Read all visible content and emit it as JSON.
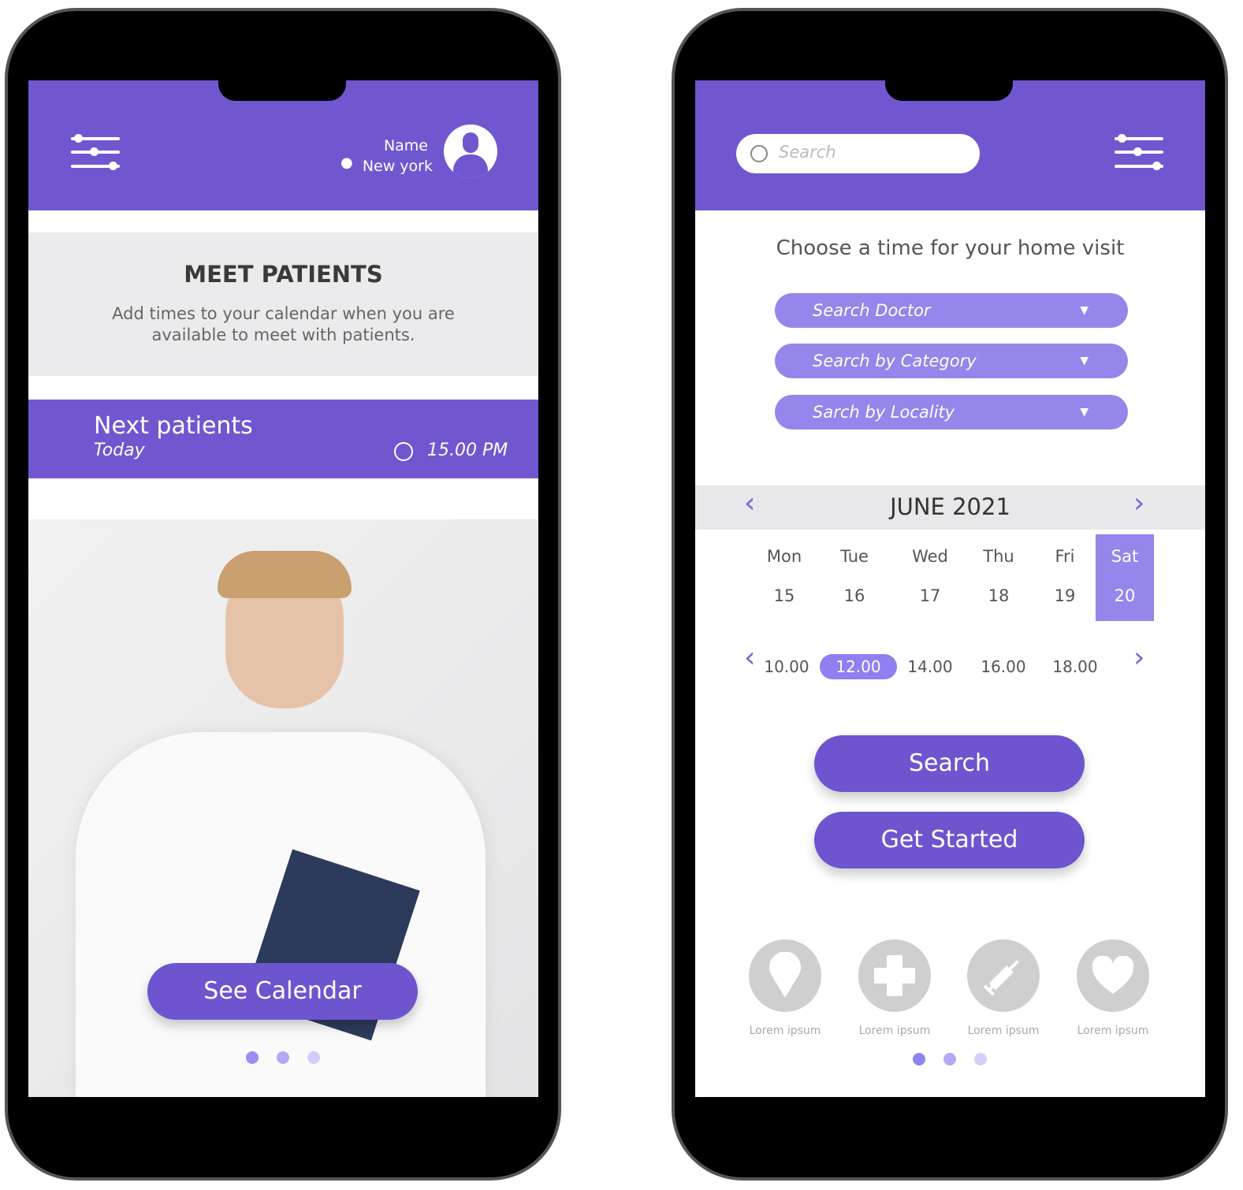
{
  "left": {
    "header": {
      "name": "Name",
      "location": "New york"
    },
    "meet": {
      "title": "MEET PATIENTS",
      "description_line1": "Add times to your calendar when you are",
      "description_line2": "available to meet with patients."
    },
    "next": {
      "title": "Next patients",
      "day": "Today",
      "time": "15.00 PM"
    },
    "cta": "See Calendar",
    "pager": {
      "count": 3,
      "active": 0
    }
  },
  "right": {
    "search_placeholder": "Search",
    "heading": "Choose a time for your home visit",
    "dropdowns": [
      "Search Doctor",
      "Search by Category",
      "Sarch by Locality"
    ],
    "calendar": {
      "month": "JUNE 2021",
      "days": [
        {
          "name": "Mon",
          "date": "15"
        },
        {
          "name": "Tue",
          "date": "16"
        },
        {
          "name": "Wed",
          "date": "17"
        },
        {
          "name": "Thu",
          "date": "18"
        },
        {
          "name": "Fri",
          "date": "19"
        },
        {
          "name": "Sat",
          "date": "20",
          "selected": true
        }
      ]
    },
    "times": [
      "10.00",
      "12.00",
      "14.00",
      "16.00",
      "18.00"
    ],
    "selected_time": "12.00",
    "search_button": "Search",
    "get_started_button": "Get Started",
    "features": [
      {
        "icon": "location-pin-icon",
        "label": "Lorem ipsum"
      },
      {
        "icon": "medical-cross-icon",
        "label": "Lorem ipsum"
      },
      {
        "icon": "syringe-icon",
        "label": "Lorem ipsum"
      },
      {
        "icon": "heart-icon",
        "label": "Lorem ipsum"
      }
    ],
    "pager": {
      "count": 3,
      "active": 0
    }
  },
  "colors": {
    "primary": "#7057cf",
    "dropdown": "#9486ea",
    "panel": "#ebebed"
  }
}
